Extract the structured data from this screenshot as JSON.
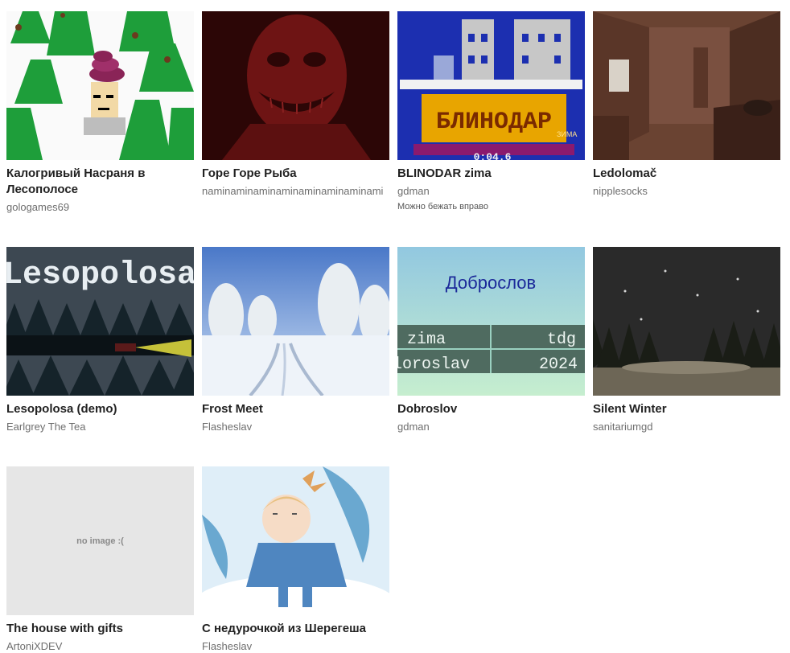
{
  "games": [
    {
      "title": "Калогривый Насраня в Лесополосе",
      "author": "gologames69"
    },
    {
      "title": "Горе Горе Рыба",
      "author": "naminaminaminaminaminaminaminami"
    },
    {
      "title": "BLINODAR zima",
      "author": "gdman",
      "description": "Можно бежать вправо",
      "thumb_text": {
        "logo": "БЛИНОДАР",
        "zima": "ЗИМА",
        "timer": "0:04.6"
      }
    },
    {
      "title": "Ledolomač",
      "author": "nipplesocks"
    },
    {
      "title": "Lesopolosa (demo)",
      "author": "Earlgrey The Tea",
      "thumb_text": {
        "logo": "Lesopolosa"
      }
    },
    {
      "title": "Frost Meet",
      "author": "Flasheslav"
    },
    {
      "title": "Dobroslov",
      "author": "gdman",
      "thumb_text": {
        "heading": "Доброслов",
        "c1": "zima",
        "c2": "tdg",
        "c3": "loroslav",
        "c4": "2024"
      }
    },
    {
      "title": "Silent Winter",
      "author": "sanitariumgd"
    },
    {
      "title": "The house with gifts",
      "author": "ArtoniXDEV",
      "thumb_text": {
        "placeholder": "no image :("
      }
    },
    {
      "title": "С недурочкой из Шерегеша",
      "author": "Flasheslav"
    }
  ],
  "colors": {
    "title": "#222222",
    "author": "#6e6e6e",
    "placeholder_bg": "#e6e6e6"
  }
}
